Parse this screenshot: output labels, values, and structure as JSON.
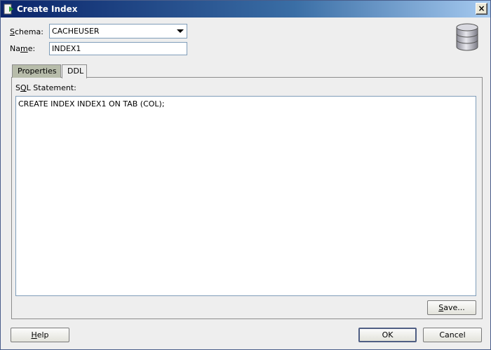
{
  "window": {
    "title": "Create Index",
    "close_glyph": "×"
  },
  "form": {
    "schema_label_mnemonic": "S",
    "schema_label_rest": "chema:",
    "schema_value": "CACHEUSER",
    "name_label_pre": "Na",
    "name_label_mnemonic": "m",
    "name_label_rest": "e:",
    "name_value": "INDEX1"
  },
  "tabs": [
    {
      "label": "Properties",
      "active": false
    },
    {
      "label": "DDL",
      "active": true
    }
  ],
  "ddl": {
    "sql_label_pre": "S",
    "sql_label_mnemonic": "Q",
    "sql_label_rest": "L Statement:",
    "sql_text": "CREATE INDEX INDEX1 ON TAB (COL);",
    "save_label_mnemonic": "S",
    "save_label_rest": "ave..."
  },
  "buttons": {
    "help_mnemonic": "H",
    "help_rest": "elp",
    "ok": "OK",
    "cancel": "Cancel"
  },
  "colors": {
    "titlebar_start": "#0a246a",
    "titlebar_end": "#a6caf0",
    "dialog_bg": "#eeeeee"
  },
  "icons": {
    "app": "app-icon",
    "database": "database-icon",
    "close": "close-icon",
    "dropdown": "chevron-down-icon"
  }
}
